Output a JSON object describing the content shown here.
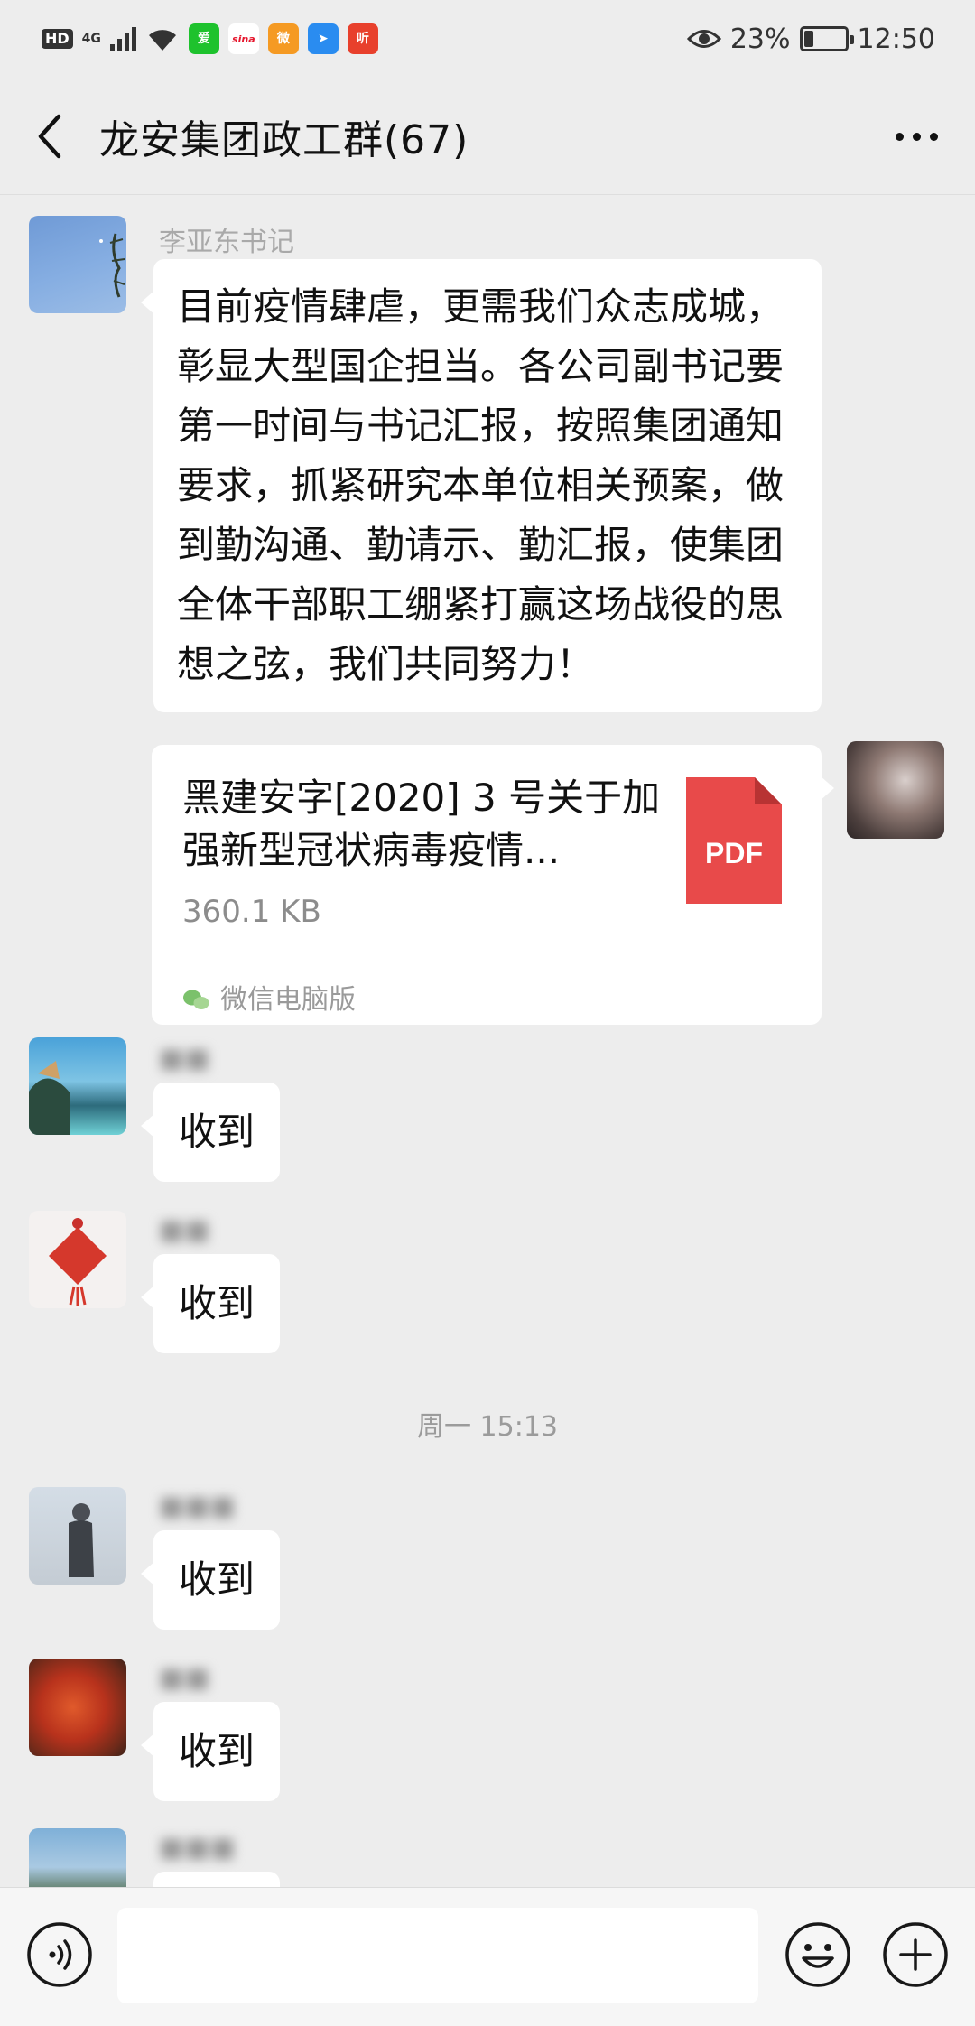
{
  "status_bar": {
    "hd": "HD",
    "network": "4G",
    "app_icons": [
      {
        "name": "iqiyi-icon",
        "label": "爱",
        "color": "#1ec22d"
      },
      {
        "name": "sina-icon",
        "label": "sina",
        "color": "#e6162d"
      },
      {
        "name": "weibo-icon",
        "label": "微",
        "color": "#f59a23"
      },
      {
        "name": "send-icon",
        "label": "➤",
        "color": "#2a8cf0"
      },
      {
        "name": "listen-icon",
        "label": "听",
        "color": "#e8402c"
      }
    ],
    "battery_percent": "23%",
    "battery_level": 0.23,
    "time": "12:50"
  },
  "header": {
    "title": "龙安集团政工群(67)"
  },
  "messages": [
    {
      "sender": "李亚东书记",
      "text": "目前疫情肆虐，更需我们众志成城，彰显大型国企担当。各公司副书记要第一时间与书记汇报，按照集团通知要求，抓紧研究本单位相关预案，做到勤沟通、勤请示、勤汇报，使集团全体干部职工绷紧打赢这场战役的思想之弦，我们共同努力！"
    },
    {
      "file_name": "黑建安字[2020] 3 号关于加强新型冠状病毒疫情...",
      "file_size": "360.1 KB",
      "file_type": "PDF",
      "source": "微信电脑版"
    },
    {
      "text": "收到"
    },
    {
      "text": "收到"
    },
    {
      "text": "收到"
    },
    {
      "text": "收到"
    }
  ],
  "timestamp": "周一 15:13"
}
